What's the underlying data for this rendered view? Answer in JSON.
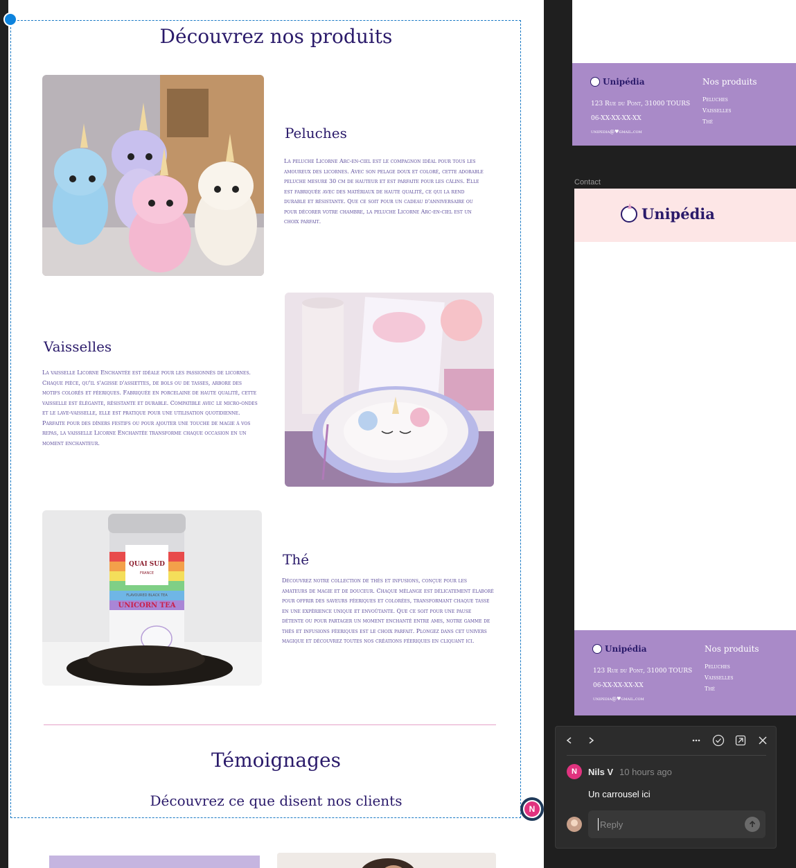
{
  "products_section": {
    "title": "Découvrez nos produits",
    "items": [
      {
        "name": "Peluches",
        "description": "La peluche Licorne Arc-en-ciel est le compagnon idéal pour tous les amoureux des licornes. Avec son pelage doux et coloré, cette adorable peluche mesure 30 cm de hauteur et est parfaite pour les câlins. Elle est fabriquée avec des matériaux de haute qualité, ce qui la rend durable et résistante. Que ce soit pour un cadeau d'anniversaire ou pour décorer votre chambre, la peluche Licorne Arc-en-ciel est un choix parfait.",
        "image_icon": "unicorn-plush-photo"
      },
      {
        "name": "Vaisselles",
        "description": "La vaisselle Licorne Enchantée est idéale pour les passionnés de licornes. Chaque pièce, qu'il s'agisse d'assiettes, de bols ou de tasses, arbore des motifs colorés et féeriques. Fabriquée en porcelaine de haute qualité, cette vaisselle est élégante, résistante et durable. Compatible avec le micro-ondes et le lave-vaisselle, elle est pratique pour une utilisation quotidienne. Parfaite pour des dîners festifs ou pour ajouter une touche de magie à vos repas, la vaisselle Licorne Enchantée transforme chaque occasion en un moment enchanteur.",
        "image_icon": "unicorn-tableware-photo"
      },
      {
        "name": "Thé",
        "description": "Découvrez notre collection de thés et infusions, conçue pour les amateurs de magie et de douceur. Chaque mélange est délicatement élaboré pour offrir des saveurs féeriques et colorées, transformant chaque tasse en une expérience unique et envoûtante. Que ce soit pour une pause détente ou pour partager un moment enchanté entre amis, notre gamme de thés et infusions féeriques est le choix parfait. Plongez dans cet univers magique et découvrez toutes nos créations féeriques en cliquant ici.",
        "image_icon": "unicorn-tea-tin-photo",
        "tin_brand": "QUAI SUD",
        "tin_sub": "FRANCE",
        "tin_flavour": "FLAVOURED BLACK TEA",
        "tin_name": "UNICORN TEA"
      }
    ]
  },
  "testimonials_section": {
    "title": "Témoignages",
    "subtitle": "Découvrez ce que disent nos clients"
  },
  "footer": {
    "logo_text": "Unipédia",
    "address": "123 Rue du Pont, 31000 TOURS",
    "phone": "06-XX-XX-XX-XX",
    "email": "unipedia@♥gmail.com",
    "heading": "Nos produits",
    "links": [
      "Peluches",
      "Vaisselles",
      "Thé"
    ]
  },
  "contact_frame": {
    "label": "Contact",
    "logo_text": "Unipédia"
  },
  "comment_pin": {
    "initial": "N"
  },
  "comment_panel": {
    "author": "Nils V",
    "author_initial": "N",
    "time": "10 hours ago",
    "message": "Un carrousel ici",
    "reply_placeholder": "Reply"
  },
  "colors": {
    "accent_purple": "#2a1a6a",
    "footer_bg": "#a98ac8",
    "contact_header_bg": "#fde6e6",
    "comment_avatar": "#e0337f",
    "selection": "#1577c4"
  }
}
